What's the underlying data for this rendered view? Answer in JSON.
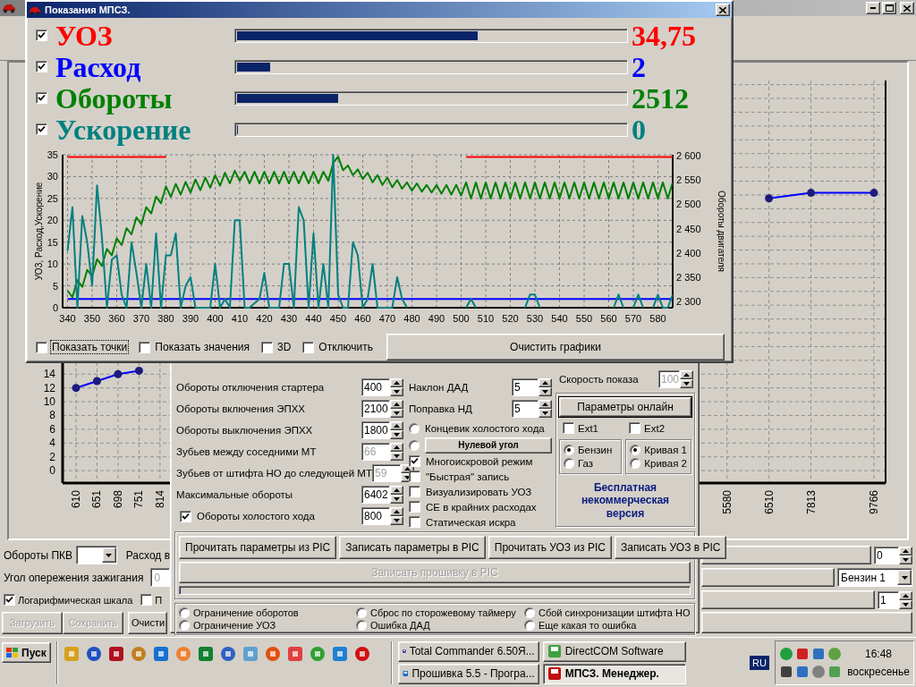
{
  "overlay_window": {
    "title": "Показания МПСЗ.",
    "meters": [
      {
        "label": "УОЗ",
        "checked": true,
        "level": 0.62,
        "reading": "34,75",
        "color": "#ff0000"
      },
      {
        "label": "Расход",
        "checked": true,
        "level": 0.085,
        "reading": "2",
        "color": "#0000ff"
      },
      {
        "label": "Обороты",
        "checked": true,
        "level": 0.26,
        "reading": "2512",
        "color": "#008000"
      },
      {
        "label": "Ускорение",
        "checked": true,
        "level": 0,
        "reading": "0",
        "color": "#008080"
      }
    ],
    "chart_data": {
      "type": "line",
      "grid": true,
      "ylabel": "УОЗ, Расход,Ускорение",
      "y2label": "Обороты двигателя",
      "xlim": [
        338,
        586
      ],
      "ylim": [
        0,
        35
      ],
      "y2lim": [
        2287,
        2602
      ],
      "xticks": [
        340,
        350,
        360,
        370,
        380,
        390,
        400,
        410,
        420,
        430,
        440,
        450,
        460,
        470,
        480,
        490,
        500,
        510,
        520,
        530,
        540,
        550,
        560,
        570,
        580
      ],
      "yticks": [
        0,
        5,
        10,
        15,
        20,
        25,
        30,
        35
      ],
      "y2ticks": [
        {
          "value": 2300,
          "label": "2 300"
        },
        {
          "value": 2350,
          "label": "2 350"
        },
        {
          "value": 2400,
          "label": "2 400"
        },
        {
          "value": 2450,
          "label": "2 450"
        },
        {
          "value": 2500,
          "label": "2 500"
        },
        {
          "value": 2550,
          "label": "2 550"
        },
        {
          "value": 2600,
          "label": "2 600"
        }
      ],
      "x": [
        340,
        342,
        344,
        346,
        348,
        350,
        352,
        354,
        356,
        358,
        360,
        362,
        364,
        366,
        368,
        370,
        372,
        374,
        376,
        378,
        380,
        382,
        384,
        386,
        388,
        390,
        392,
        394,
        396,
        398,
        400,
        402,
        404,
        406,
        408,
        410,
        412,
        414,
        416,
        418,
        420,
        422,
        424,
        426,
        428,
        430,
        432,
        434,
        436,
        438,
        440,
        442,
        444,
        446,
        448,
        450,
        452,
        454,
        456,
        458,
        460,
        462,
        464,
        466,
        468,
        470,
        472,
        474,
        476,
        478,
        480,
        482,
        484,
        486,
        488,
        490,
        492,
        494,
        496,
        498,
        500,
        502,
        504,
        506,
        508,
        510,
        512,
        514,
        516,
        518,
        520,
        522,
        524,
        526,
        528,
        530,
        532,
        534,
        536,
        538,
        540,
        542,
        544,
        546,
        548,
        550,
        552,
        554,
        556,
        558,
        560,
        562,
        564,
        566,
        568,
        570,
        572,
        574,
        576,
        578,
        580,
        582,
        584,
        586
      ],
      "series": [
        {
          "color": "#ff0000",
          "values": [
            34.5,
            34.5,
            34.5,
            34.5,
            34.5,
            34.5,
            34.5,
            34.5,
            34.5,
            34.5,
            34.5,
            34.5,
            34.5,
            34.5,
            34.5,
            34.5,
            34.5,
            34.5,
            34.5,
            34.5,
            34.5,
            null,
            null,
            null,
            null,
            null,
            null,
            null,
            null,
            null,
            null,
            null,
            null,
            null,
            null,
            null,
            null,
            null,
            null,
            null,
            null,
            null,
            null,
            null,
            null,
            null,
            null,
            null,
            null,
            null,
            null,
            null,
            null,
            null,
            null,
            null,
            null,
            null,
            null,
            null,
            null,
            null,
            null,
            null,
            null,
            null,
            null,
            null,
            null,
            null,
            null,
            null,
            null,
            null,
            null,
            null,
            null,
            null,
            null,
            null,
            null,
            34.5,
            34.5,
            34.5,
            34.5,
            34.5,
            34.5,
            34.5,
            34.5,
            34.5,
            34.5,
            34.5,
            34.5,
            34.5,
            34.5,
            34.5,
            34.5,
            34.5,
            34.5,
            34.5,
            34.5,
            34.5,
            34.5,
            34.5,
            34.5,
            34.5,
            34.5,
            34.5,
            34.5,
            34.5,
            34.5,
            34.5,
            34.5,
            34.5,
            34.5,
            34.5,
            34.5,
            34.5,
            34.5,
            34.5,
            34.5,
            34.5,
            34.5,
            34.5
          ]
        },
        {
          "color": "#0000ff",
          "values": [
            2,
            2,
            2,
            2,
            2,
            2,
            2,
            2,
            2,
            2,
            2,
            2,
            2,
            2,
            2,
            2,
            2,
            2,
            2,
            2,
            2,
            2,
            2,
            2,
            2,
            2,
            2,
            2,
            2,
            2,
            2,
            2,
            2,
            2,
            2,
            2,
            2,
            2,
            2,
            2,
            2,
            2,
            2,
            2,
            2,
            2,
            2,
            2,
            2,
            2,
            2,
            2,
            2,
            2,
            2,
            2,
            2,
            2,
            2,
            2,
            2,
            2,
            2,
            2,
            2,
            2,
            2,
            2,
            2,
            2,
            2,
            2,
            2,
            2,
            2,
            2,
            2,
            2,
            2,
            2,
            2,
            2,
            2,
            2,
            2,
            2,
            2,
            2,
            2,
            2,
            2,
            2,
            2,
            2,
            2,
            2,
            2,
            2,
            2,
            2,
            2,
            2,
            2,
            2,
            2,
            2,
            2,
            2,
            2,
            2,
            2,
            2,
            2,
            2,
            2,
            2,
            2,
            2,
            2,
            2,
            2,
            2,
            2,
            2
          ]
        },
        {
          "color": "#008000",
          "axis": "y2",
          "values": [
            2322,
            2309,
            2344,
            2330,
            2365,
            2352,
            2387,
            2373,
            2408,
            2395,
            2430,
            2416,
            2451,
            2438,
            2473,
            2459,
            2494,
            2481,
            2516,
            2502,
            2537,
            2515,
            2542,
            2520,
            2546,
            2524,
            2551,
            2529,
            2555,
            2534,
            2560,
            2538,
            2565,
            2543,
            2569,
            2548,
            2567,
            2543,
            2567,
            2543,
            2567,
            2543,
            2567,
            2543,
            2567,
            2543,
            2567,
            2543,
            2567,
            2543,
            2567,
            2543,
            2567,
            2548,
            2585,
            2598,
            2570,
            2580,
            2560,
            2572,
            2552,
            2565,
            2545,
            2560,
            2540,
            2555,
            2535,
            2550,
            2532,
            2545,
            2528,
            2543,
            2526,
            2540,
            2524,
            2540,
            2522,
            2540,
            2520,
            2540,
            2518,
            2545,
            2512,
            2545,
            2512,
            2545,
            2512,
            2545,
            2512,
            2545,
            2512,
            2545,
            2512,
            2545,
            2512,
            2545,
            2512,
            2545,
            2512,
            2545,
            2512,
            2545,
            2512,
            2545,
            2512,
            2545,
            2512,
            2545,
            2512,
            2545,
            2512,
            2545,
            2512,
            2545,
            2512,
            2545,
            2512,
            2545,
            2512,
            2545,
            2512,
            2545,
            2512,
            2545
          ]
        },
        {
          "color": "#008080",
          "values": [
            13,
            23,
            0,
            21,
            15,
            5,
            28,
            16,
            0,
            11,
            12,
            3,
            0,
            15,
            8,
            0,
            10,
            0,
            17,
            0,
            12,
            12,
            17,
            0,
            5,
            7,
            0,
            0,
            0,
            0,
            10,
            0,
            2,
            0,
            20,
            20,
            0,
            0,
            1,
            2,
            8,
            0,
            0,
            0,
            10,
            10,
            0,
            23,
            20,
            0,
            17,
            0,
            10,
            0,
            35,
            3,
            0,
            0,
            15,
            12,
            0,
            2,
            10,
            0,
            0,
            0,
            0,
            7,
            2,
            0,
            null,
            null,
            null,
            null,
            null,
            null,
            null,
            null,
            null,
            null,
            null,
            0,
            2,
            0,
            null,
            null,
            null,
            null,
            null,
            null,
            null,
            null,
            null,
            0,
            3,
            3,
            0,
            null,
            null,
            null,
            null,
            null,
            null,
            null,
            null,
            null,
            null,
            null,
            null,
            null,
            null,
            0,
            3,
            0,
            null,
            0,
            3,
            0,
            null,
            0,
            3,
            0,
            0,
            3
          ]
        }
      ]
    },
    "options": [
      {
        "label": "Показать точки",
        "checked": false,
        "focused": true
      },
      {
        "label": "Показать значения",
        "checked": false,
        "focused": false
      },
      {
        "label": "3D",
        "checked": false,
        "focused": false
      },
      {
        "label": "Отключить",
        "checked": false,
        "focused": false
      }
    ],
    "clear_button": "Очистить графики"
  },
  "main_window": {
    "chart_data": {
      "type": "line",
      "grid": true,
      "ylim": [
        -1.8,
        56.6
      ],
      "yticks": [
        0,
        2,
        4,
        6,
        8,
        10,
        12,
        14
      ],
      "categories": [
        "610",
        "651",
        "698",
        "751",
        "814",
        null,
        null,
        null,
        null,
        null,
        null,
        null,
        null,
        null,
        null,
        null,
        null,
        null,
        null,
        null,
        null,
        null,
        null,
        null,
        null,
        null,
        null,
        null,
        null,
        null,
        null,
        "5580",
        null,
        "6510",
        null,
        "7813",
        null,
        null,
        "9766"
      ],
      "series": [
        {
          "color": "#0000ff",
          "marker": true,
          "values": [
            12,
            13,
            14,
            14.5,
            null,
            null,
            null,
            null,
            null,
            null,
            null,
            null,
            null,
            null,
            null,
            null,
            null,
            null,
            null,
            null,
            null,
            null,
            null,
            null,
            null,
            null,
            null,
            null,
            null,
            null,
            null,
            null,
            null,
            39.5,
            null,
            40.3,
            null,
            null,
            40.3
          ]
        }
      ]
    },
    "bottom_left": {
      "pkv_label": "Обороты ПКВ",
      "flow_label": "Расход в",
      "angle_label": "Угол опережения зажигания",
      "angle_value": "0",
      "checks": [
        {
          "label": "Логарифмическая шкала",
          "checked": true
        },
        {
          "label": "П",
          "checked": false
        }
      ],
      "buttons": [
        {
          "label": "Загрузить",
          "disabled": true
        },
        {
          "label": "Сохранить",
          "disabled": true
        },
        {
          "label": "Очисти",
          "disabled": false
        }
      ]
    },
    "bottom_right": {
      "spin_1": "0",
      "fuel_select": "Бензин 1",
      "spin_2": "1"
    }
  },
  "settings_panel": {
    "params": [
      {
        "kind": "plain",
        "label": "Обороты отключения стартера",
        "value": "400",
        "disabled": false
      },
      {
        "kind": "plain",
        "label": "Обороты включения ЭПХХ",
        "value": "2100",
        "disabled": false
      },
      {
        "kind": "plain",
        "label": "Обороты выключения ЭПХХ",
        "value": "1800",
        "disabled": false
      },
      {
        "kind": "plain",
        "label": "Зубьев между соседними МТ",
        "value": "66",
        "disabled": true
      },
      {
        "kind": "plain",
        "label": "Зубьев от штифта НО до следующей МТ",
        "value": "59",
        "disabled": true
      },
      {
        "kind": "plain",
        "label": "Максимальные обороты",
        "value": "6402",
        "disabled": false
      },
      {
        "kind": "checkbox",
        "label": "Обороты холостого хода",
        "value": "800",
        "checked": true,
        "disabled": false
      }
    ],
    "sensor_params": [
      {
        "label": "Наклон ДАД",
        "value": "5"
      },
      {
        "label": "Поправка НД",
        "value": "5"
      }
    ],
    "mode_radios": [
      {
        "kind": "label",
        "label": "Концевик холостого хода",
        "selected": false
      },
      {
        "kind": "button",
        "label": "Нулевой угол",
        "selected": false
      }
    ],
    "flags": [
      {
        "label": "Многоискровой режим",
        "checked": true
      },
      {
        "label": "\"Быстрая\" запись",
        "checked": false
      },
      {
        "label": "Визуализировать УОЗ",
        "checked": false
      },
      {
        "label": "СЕ в крайних расходах",
        "checked": false
      },
      {
        "label": "Статическая искра",
        "checked": false
      }
    ],
    "display_speed": {
      "label": "Скорость показа",
      "value": "100",
      "disabled": true
    },
    "online_button": "Параметры  онлайн",
    "ext": [
      {
        "label": "Ext1",
        "checked": false
      },
      {
        "label": "Ext2",
        "checked": false
      }
    ],
    "fuel": [
      {
        "label": "Бензин",
        "selected": true
      },
      {
        "label": "Газ",
        "selected": false
      }
    ],
    "curve": [
      {
        "label": "Кривая 1",
        "selected": true
      },
      {
        "label": "Кривая 2",
        "selected": false
      }
    ],
    "license_note": "Бесплатная некоммерческая версия",
    "actions": [
      "Прочитать параметры из PIC",
      "Записать параметры в PIC",
      "Прочитать УОЗ из PIC",
      "Записать УОЗ в PIC"
    ],
    "flash_button": {
      "label": "Записать прошивку в PIC",
      "disabled": true
    },
    "progress": {
      "level": 0
    },
    "errors": [
      {
        "label": "Ограничение оборотов",
        "on": false
      },
      {
        "label": "Ограничение УОЗ",
        "on": false
      },
      {
        "label": "Сброс по сторожевому таймеру",
        "on": false
      },
      {
        "label": "Ошибка ДАД",
        "on": false
      },
      {
        "label": "Сбой синхронизации штифта НО",
        "on": false
      },
      {
        "label": "Еще какая то ошибка",
        "on": false
      }
    ]
  },
  "taskbar": {
    "start": "Пуск",
    "tasks": [
      {
        "label": "Total Commander 6.50Я...",
        "selected": false
      },
      {
        "label": "DirectCOM Software",
        "selected": false
      },
      {
        "label": "Прошивка 5.5 - Програ...",
        "selected": false
      },
      {
        "label": "МПСЗ. Менеджер.",
        "selected": true
      }
    ],
    "language": "RU",
    "time": "16:48",
    "day": "воскресенье"
  }
}
